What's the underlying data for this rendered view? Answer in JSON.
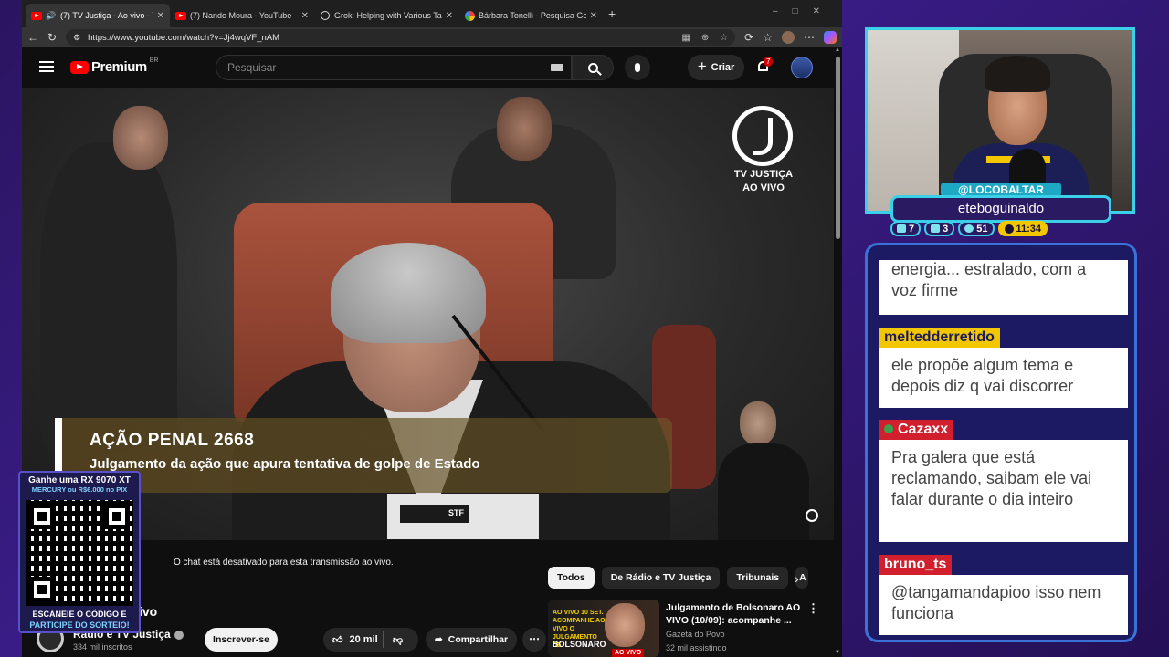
{
  "browser": {
    "tabs": [
      {
        "title": "(7) TV Justiça - Ao vivo - YouTube",
        "favicon": "youtube-icon",
        "active": true
      },
      {
        "title": "(7) Nando Moura - YouTube",
        "favicon": "youtube-icon",
        "active": false
      },
      {
        "title": "Grok: Helping with Various Tasks",
        "favicon": "grok-icon",
        "active": false
      },
      {
        "title": "Bárbara Tonelli - Pesquisa Google",
        "favicon": "google-icon",
        "active": false
      }
    ],
    "url": "https://www.youtube.com/watch?v=Jj4wqVF_nAM"
  },
  "youtube": {
    "logo_text": "Premium",
    "logo_region": "BR",
    "search_placeholder": "Pesquisar",
    "create_label": "Criar",
    "notification_count": "7",
    "video": {
      "watermark_line1": "TV JUSTIÇA",
      "watermark_line2": "AO VIVO",
      "lower_third_title": "AÇÃO PENAL 2668",
      "lower_third_subtitle": "Julgamento da ação que apura tentativa de golpe de Estado",
      "plate_label": "STF"
    },
    "chat_disabled": "O chat está desativado para esta transmissão ao vivo.",
    "title_fragment": "ivo",
    "channel": {
      "name": "Rádio e TV Justiça",
      "subscribers": "334 mil inscritos",
      "subscribe_label": "Inscrever-se"
    },
    "likes": "20 mil",
    "share_label": "Compartilhar",
    "chips": [
      "Todos",
      "De Rádio e TV Justiça",
      "Tribunais",
      "A"
    ],
    "recommendation": {
      "title": "Julgamento de Bolsonaro AO VIVO (10/09): acompanhe ...",
      "channel": "Gazeta do Povo",
      "views": "32 mil assistindo",
      "thumb_text1": "AO VIVO 10 SET. ACOMPANHE AO VIVO O JULGAMENTO DE",
      "thumb_text2": "BOLSONARO",
      "thumb_live": "AO VIVO"
    }
  },
  "promo": {
    "line1": "Ganhe uma RX 9070 XT",
    "line2": "MERCURY ou R$6.000 no PIX",
    "footer1": "ESCANEIE O CÓDIGO E",
    "footer2": "PARTICIPE DO SORTEIO!"
  },
  "stream": {
    "handle": "@LOCOBALTAR",
    "name": "eteboguinaldo",
    "stats": [
      {
        "icon": "chat-icon",
        "value": "7"
      },
      {
        "icon": "video-icon",
        "value": "3"
      },
      {
        "icon": "users-icon",
        "value": "51"
      },
      {
        "icon": "clock-icon",
        "value": "11:34"
      }
    ]
  },
  "chat": {
    "messages": [
      {
        "user": "",
        "text": "energia... estralado, com a voz firme"
      },
      {
        "user": "meltedderretido",
        "text": "ele propõe algum tema e depois diz q vai discorrer"
      },
      {
        "user": "Cazaxx",
        "text": "Pra galera que está reclamando, saibam ele vai falar durante o dia inteiro"
      },
      {
        "user": "bruno_ts",
        "text": "@tangamandapioo isso nem funciona"
      }
    ]
  },
  "colors": {
    "accent_cyan": "#3ad0e8",
    "accent_yellow": "#f3c700",
    "youtube_red": "#ff0000",
    "chat_bg": "#1c1a62"
  }
}
